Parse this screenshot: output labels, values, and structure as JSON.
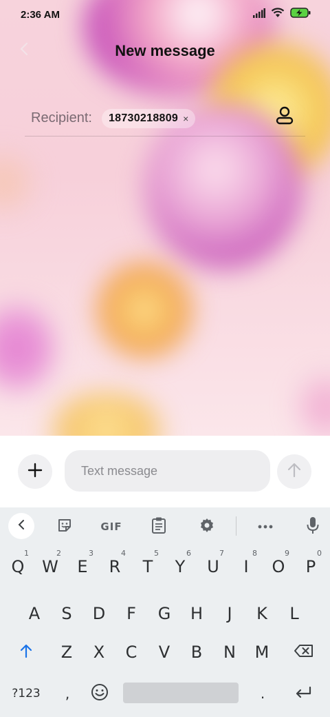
{
  "status_bar": {
    "time": "2:36 AM",
    "icons": [
      "signal-icon",
      "wifi-icon",
      "battery-charging-icon"
    ]
  },
  "header": {
    "title": "New message",
    "back_icon": "chevron-left-icon"
  },
  "recipient": {
    "label": "Recipient:",
    "chip_value": "18730218809",
    "chip_remove": "×",
    "contact_icon": "contact-person-icon"
  },
  "compose": {
    "placeholder": "Text message",
    "value": "",
    "attach_icon": "plus-icon",
    "send_icon": "arrow-up-icon"
  },
  "keyboard": {
    "toolbar": {
      "back_icon": "chevron-left-icon",
      "sticker_icon": "sticker-icon",
      "gif_label": "GIF",
      "clipboard_icon": "clipboard-icon",
      "settings_icon": "gear-icon",
      "more_icon": "more-horizontal-icon",
      "mic_icon": "microphone-icon"
    },
    "row1": [
      {
        "ch": "Q",
        "num": "1"
      },
      {
        "ch": "W",
        "num": "2"
      },
      {
        "ch": "E",
        "num": "3"
      },
      {
        "ch": "R",
        "num": "4"
      },
      {
        "ch": "T",
        "num": "5"
      },
      {
        "ch": "Y",
        "num": "6"
      },
      {
        "ch": "U",
        "num": "7"
      },
      {
        "ch": "I",
        "num": "8"
      },
      {
        "ch": "O",
        "num": "9"
      },
      {
        "ch": "P",
        "num": "0"
      }
    ],
    "row2": [
      "A",
      "S",
      "D",
      "F",
      "G",
      "H",
      "J",
      "K",
      "L"
    ],
    "row3": [
      "Z",
      "X",
      "C",
      "V",
      "B",
      "N",
      "M"
    ],
    "shift_icon": "shift-arrow-icon",
    "backspace_icon": "backspace-icon",
    "row4": {
      "symbols": "?123",
      "comma": ",",
      "emoji_icon": "emoji-icon",
      "period": ".",
      "enter_icon": "enter-icon"
    }
  },
  "colors": {
    "accent_blue": "#1a73e8",
    "key_text": "#2d2f31"
  }
}
